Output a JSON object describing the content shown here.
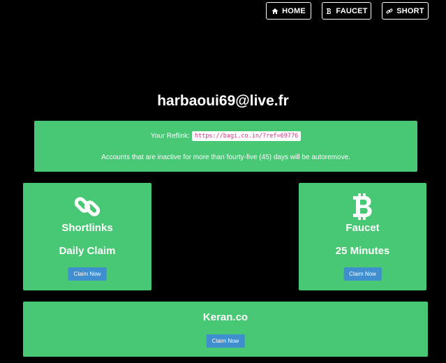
{
  "nav": {
    "home_label": "HOME",
    "faucet_label": "FAUCET",
    "short_label": "SHORT"
  },
  "user": {
    "email": "harbaoui69@live.fr"
  },
  "reflink": {
    "label": "Your Reflink:",
    "url": "https://bagi.co.in/?ref=69776",
    "note": "Accounts that are inactive for more than fourty-five (45) days will be autoremove."
  },
  "cards": {
    "shortlinks": {
      "icon": "link-icon",
      "title": "Shortlinks",
      "subtitle": "Daily Claim",
      "button": "Claim Now"
    },
    "faucet": {
      "icon": "bitcoin-icon",
      "title": "Faucet",
      "subtitle": "25 Minutes",
      "button": "Claim Now"
    },
    "keran": {
      "title": "Keran.co",
      "button": "Claim Now"
    }
  },
  "colors": {
    "background": "#000000",
    "panel": "#48c774",
    "button": "#3e8ed0",
    "code_text": "#d63384"
  }
}
